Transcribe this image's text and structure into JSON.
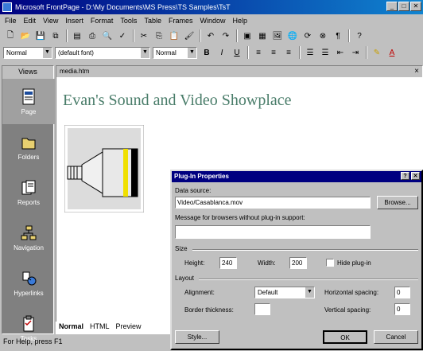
{
  "window": {
    "title": "Microsoft FrontPage - D:\\My Documents\\MS Press\\TS Samples\\TsT"
  },
  "menu": [
    "File",
    "Edit",
    "View",
    "Insert",
    "Format",
    "Tools",
    "Table",
    "Frames",
    "Window",
    "Help"
  ],
  "format_toolbar": {
    "style": "Normal",
    "font": "(default font)",
    "size": "Normal"
  },
  "views": {
    "header": "Views",
    "items": [
      {
        "label": "Page",
        "active": true
      },
      {
        "label": "Folders"
      },
      {
        "label": "Reports"
      },
      {
        "label": "Navigation"
      },
      {
        "label": "Hyperlinks"
      },
      {
        "label": "Tasks"
      }
    ]
  },
  "editor": {
    "file_tab": "media.htm",
    "heading": "Evan's Sound and Video Showplace",
    "bottom_tabs": [
      "Normal",
      "HTML",
      "Preview"
    ]
  },
  "status": "For Help, press F1",
  "dialog": {
    "title": "Plug-In Properties",
    "data_source_label": "Data source:",
    "data_source_value": "Video/Casablanca.mov",
    "browse_label": "Browse...",
    "message_label": "Message for browsers without plug-in support:",
    "message_value": "",
    "size_group": "Size",
    "height_label": "Height:",
    "height_value": "240",
    "width_label": "Width:",
    "width_value": "200",
    "hide_plugin_label": "Hide plug-in",
    "layout_group": "Layout",
    "alignment_label": "Alignment:",
    "alignment_value": "Default",
    "horizontal_spacing_label": "Horizontal spacing:",
    "horizontal_spacing_value": "0",
    "border_thickness_label": "Border thickness:",
    "border_thickness_value": "",
    "vertical_spacing_label": "Vertical spacing:",
    "vertical_spacing_value": "0",
    "style_button": "Style...",
    "ok_button": "OK",
    "cancel_button": "Cancel"
  }
}
